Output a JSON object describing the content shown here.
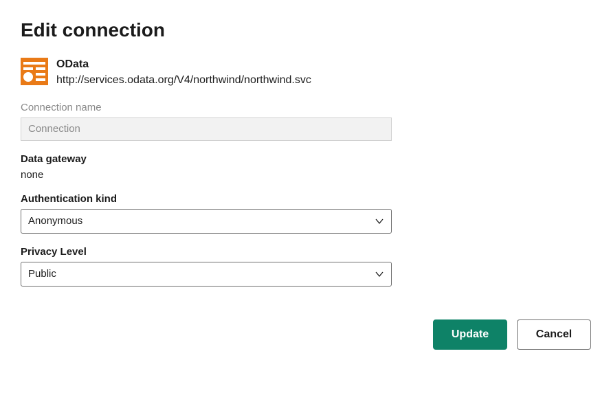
{
  "title": "Edit connection",
  "datasource": {
    "icon_name": "odata-icon",
    "name": "OData",
    "url": "http://services.odata.org/V4/northwind/northwind.svc"
  },
  "fields": {
    "connection_name": {
      "label": "Connection name",
      "placeholder": "Connection",
      "value": ""
    },
    "data_gateway": {
      "label": "Data gateway",
      "value": "none"
    },
    "authentication_kind": {
      "label": "Authentication kind",
      "selected": "Anonymous"
    },
    "privacy_level": {
      "label": "Privacy Level",
      "selected": "Public"
    }
  },
  "buttons": {
    "update": "Update",
    "cancel": "Cancel"
  },
  "colors": {
    "primary": "#0e8267",
    "icon_orange": "#e97a17"
  }
}
